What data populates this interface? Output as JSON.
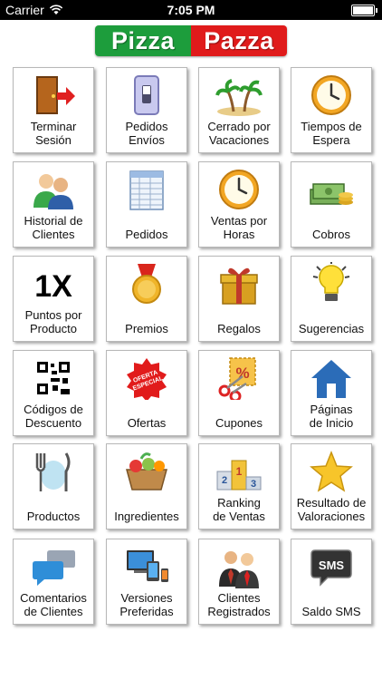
{
  "status_bar": {
    "carrier": "Carrier",
    "time": "7:05 PM"
  },
  "logo": {
    "part1": "Pizza",
    "part2": "Pazza"
  },
  "tiles": [
    {
      "label": "Terminar\nSesión",
      "icon": "logout-door-icon"
    },
    {
      "label": "Pedidos\nEnvíos",
      "icon": "switch-icon"
    },
    {
      "label": "Cerrado por\nVacaciones",
      "icon": "palm-island-icon"
    },
    {
      "label": "Tiempos de\nEspera",
      "icon": "clock-icon"
    },
    {
      "label": "Historial de\nClientes",
      "icon": "users-icon"
    },
    {
      "label": "Pedidos",
      "icon": "spreadsheet-icon"
    },
    {
      "label": "Ventas por\nHoras",
      "icon": "clock-icon"
    },
    {
      "label": "Cobros",
      "icon": "money-icon"
    },
    {
      "label": "Puntos por\nProducto",
      "icon": "1x-icon",
      "icon_text": "1X"
    },
    {
      "label": "Premios",
      "icon": "medal-icon"
    },
    {
      "label": "Regalos",
      "icon": "gift-icon"
    },
    {
      "label": "Sugerencias",
      "icon": "lightbulb-icon"
    },
    {
      "label": "Códigos de\nDescuento",
      "icon": "qr-code-icon"
    },
    {
      "label": "Ofertas",
      "icon": "offer-badge-icon",
      "icon_text": "OFERTA ESPECIAL"
    },
    {
      "label": "Cupones",
      "icon": "coupon-scissors-icon",
      "icon_text": "%"
    },
    {
      "label": "Páginas\nde Inicio",
      "icon": "home-icon"
    },
    {
      "label": "Productos",
      "icon": "cutlery-icon"
    },
    {
      "label": "Ingredientes",
      "icon": "vegetable-basket-icon"
    },
    {
      "label": "Ranking\nde Ventas",
      "icon": "podium-icon",
      "icon_text": [
        "2",
        "1",
        "3"
      ]
    },
    {
      "label": "Resultado de\nValoraciones",
      "icon": "star-icon"
    },
    {
      "label": "Comentarios\nde Clientes",
      "icon": "chat-bubbles-icon"
    },
    {
      "label": "Versiones\nPreferidas",
      "icon": "devices-icon"
    },
    {
      "label": "Clientes\nRegistrados",
      "icon": "business-people-icon"
    },
    {
      "label": "Saldo SMS",
      "icon": "sms-bubble-icon",
      "icon_text": "SMS"
    }
  ]
}
